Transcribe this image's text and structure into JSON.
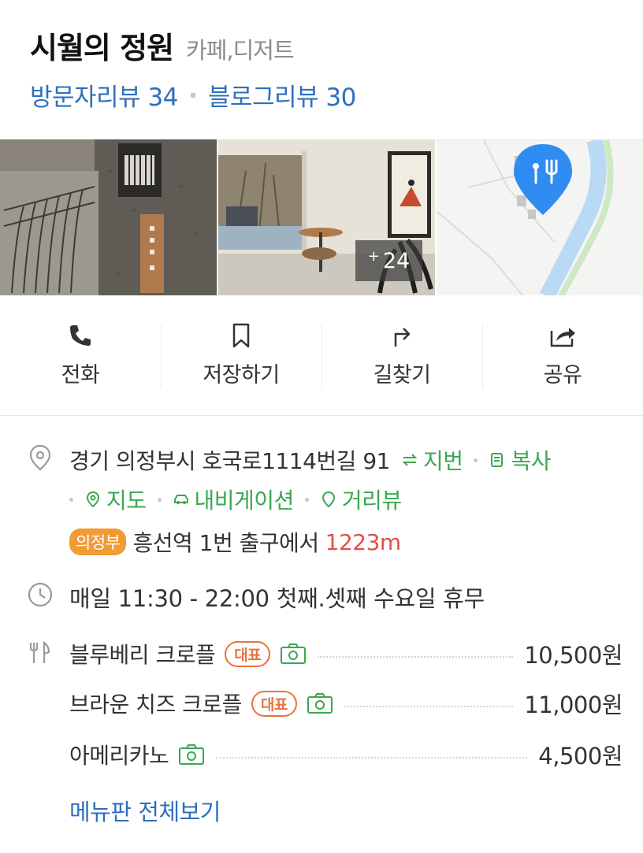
{
  "place": {
    "name": "시월의 정원",
    "category": "카페,디저트",
    "visitor_reviews": "방문자리뷰 34",
    "blog_reviews": "블로그리뷰 30"
  },
  "photos": {
    "more_count": "24",
    "more_prefix": "+"
  },
  "actions": [
    {
      "label": "전화",
      "icon": "phone-icon"
    },
    {
      "label": "저장하기",
      "icon": "bookmark-icon"
    },
    {
      "label": "길찾기",
      "icon": "directions-icon"
    },
    {
      "label": "공유",
      "icon": "share-icon"
    }
  ],
  "address": {
    "text": "경기 의정부시 호국로1114번길 91",
    "lot_toggle": "지번",
    "copy": "복사",
    "map": "지도",
    "navigation": "내비게이션",
    "street_view": "거리뷰",
    "station_badge": "의정부",
    "station_text": "흥선역 1번 출구에서",
    "distance": "1223m"
  },
  "hours": {
    "text": "매일 11:30 - 22:00 첫째.셋째 수요일 휴무"
  },
  "menu": {
    "items": [
      {
        "name": "블루베리 크로플",
        "badge": "대표",
        "price": "10,500원"
      },
      {
        "name": "브라운 치즈 크로플",
        "badge": "대표",
        "price": "11,000원"
      },
      {
        "name": "아메리카노",
        "badge": "",
        "price": "4,500원"
      }
    ],
    "view_all": "메뉴판 전체보기"
  },
  "colors": {
    "link_blue": "#2f6fbd",
    "green": "#3aa852",
    "orange_badge": "#f29b33",
    "red_distance": "#e0504a",
    "map_pin": "#2f8cf0"
  }
}
